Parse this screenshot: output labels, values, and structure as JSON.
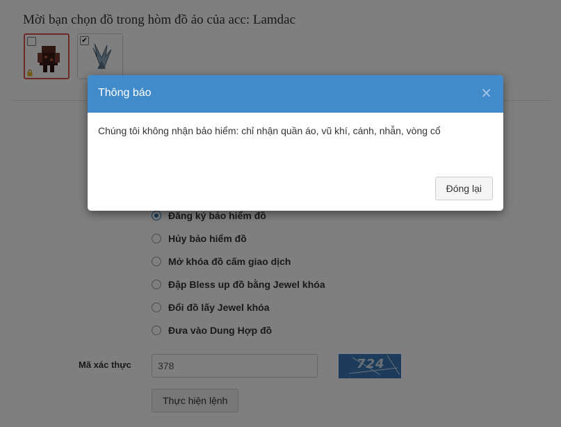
{
  "heading": "Mời bạn chọn đồ trong hòm đồ ảo của acc: Lamdac",
  "items": [
    {
      "checked": false,
      "locked": true,
      "selected": true,
      "icon": "armor-item-icon"
    },
    {
      "checked": true,
      "locked": false,
      "selected": false,
      "icon": "wings-item-icon"
    }
  ],
  "options": [
    {
      "label": "Đăng ký bảo hiểm đồ",
      "checked": true
    },
    {
      "label": "Hủy bảo hiểm đồ",
      "checked": false
    },
    {
      "label": "Mở khóa đồ cấm giao dịch",
      "checked": false
    },
    {
      "label": "Đập Bless up đồ bằng Jewel khóa",
      "checked": false
    },
    {
      "label": "Đổi đồ lấy Jewel khóa",
      "checked": false
    },
    {
      "label": "Đưa vào Dung Hợp đồ",
      "checked": false
    }
  ],
  "captcha": {
    "label": "Mã xác thực",
    "value": "378",
    "image_text": "724"
  },
  "submit_label": "Thực hiện lệnh",
  "modal": {
    "title": "Thông báo",
    "close_symbol": "×",
    "message": "Chúng tôi không nhận bảo hiểm: chỉ nhận quần áo, vũ khí, cánh, nhẫn, vòng cổ",
    "close_button": "Đóng lại"
  },
  "colors": {
    "modal_header": "#428bca",
    "item_selected_border": "#d9534f",
    "captcha_bg": "#3a76b5"
  }
}
